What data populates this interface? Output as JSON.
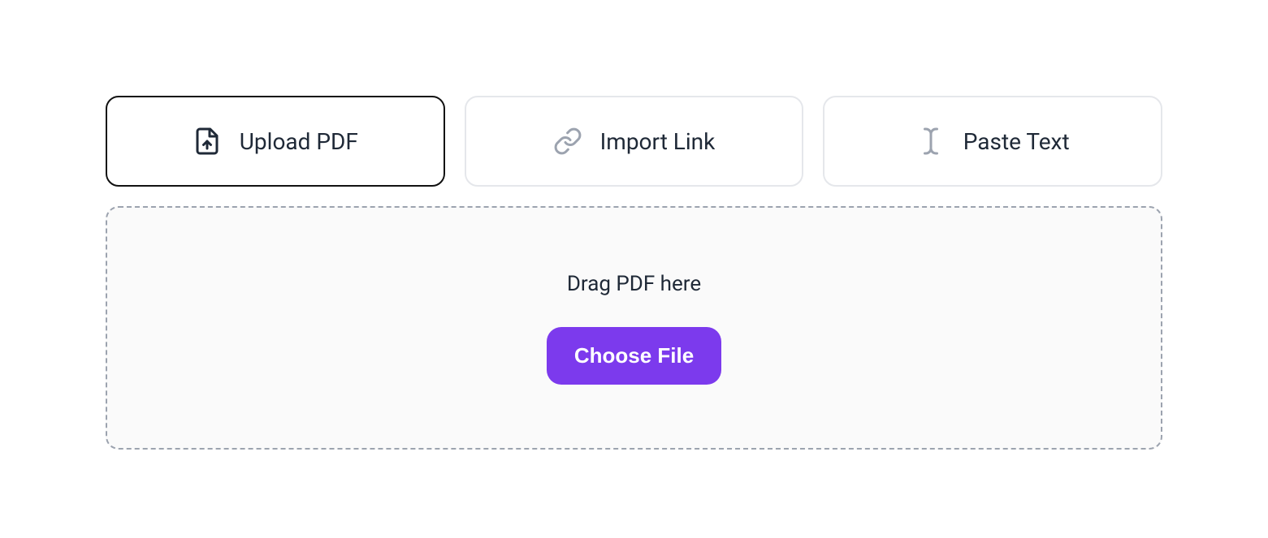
{
  "tabs": {
    "upload_pdf": {
      "label": "Upload PDF"
    },
    "import_link": {
      "label": "Import Link"
    },
    "paste_text": {
      "label": "Paste Text"
    }
  },
  "dropzone": {
    "text": "Drag PDF here",
    "button_label": "Choose File"
  },
  "colors": {
    "accent": "#7c3aed"
  }
}
